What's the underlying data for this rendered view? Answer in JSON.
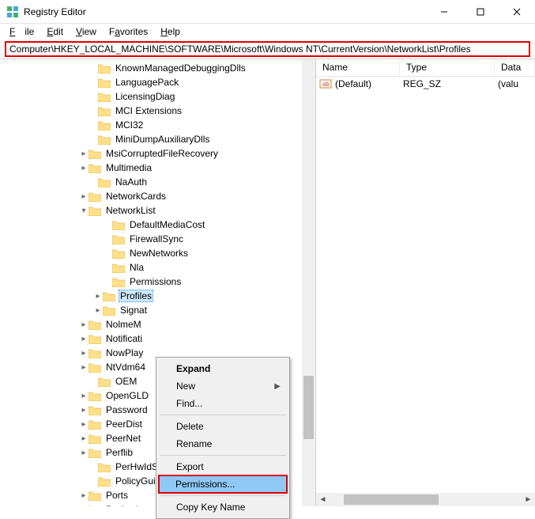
{
  "window": {
    "title": "Registry Editor"
  },
  "menus": {
    "file": "File",
    "edit": "Edit",
    "view": "View",
    "favorites": "Favorites",
    "help": "Help"
  },
  "address": "Computer\\HKEY_LOCAL_MACHINE\\SOFTWARE\\Microsoft\\Windows NT\\CurrentVersion\\NetworkList\\Profiles",
  "tree": [
    {
      "indent": 112,
      "caret": "",
      "label": "KnownManagedDebuggingDlls"
    },
    {
      "indent": 112,
      "caret": "",
      "label": "LanguagePack"
    },
    {
      "indent": 112,
      "caret": "",
      "label": "LicensingDiag"
    },
    {
      "indent": 112,
      "caret": "",
      "label": "MCI Extensions"
    },
    {
      "indent": 112,
      "caret": "",
      "label": "MCI32"
    },
    {
      "indent": 112,
      "caret": "",
      "label": "MiniDumpAuxiliaryDlls"
    },
    {
      "indent": 100,
      "caret": ">",
      "label": "MsiCorruptedFileRecovery"
    },
    {
      "indent": 100,
      "caret": ">",
      "label": "Multimedia"
    },
    {
      "indent": 112,
      "caret": "",
      "label": "NaAuth"
    },
    {
      "indent": 100,
      "caret": ">",
      "label": "NetworkCards"
    },
    {
      "indent": 100,
      "caret": "v",
      "label": "NetworkList"
    },
    {
      "indent": 130,
      "caret": "",
      "label": "DefaultMediaCost"
    },
    {
      "indent": 130,
      "caret": "",
      "label": "FirewallSync"
    },
    {
      "indent": 130,
      "caret": "",
      "label": "NewNetworks"
    },
    {
      "indent": 130,
      "caret": "",
      "label": "Nla"
    },
    {
      "indent": 130,
      "caret": "",
      "label": "Permissions"
    },
    {
      "indent": 118,
      "caret": ">",
      "label": "Profiles",
      "selected": true
    },
    {
      "indent": 118,
      "caret": ">",
      "label": "Signat"
    },
    {
      "indent": 100,
      "caret": ">",
      "label": "NolmeM"
    },
    {
      "indent": 100,
      "caret": ">",
      "label": "Notificati"
    },
    {
      "indent": 100,
      "caret": ">",
      "label": "NowPlay"
    },
    {
      "indent": 100,
      "caret": ">",
      "label": "NtVdm64"
    },
    {
      "indent": 112,
      "caret": "",
      "label": "OEM"
    },
    {
      "indent": 100,
      "caret": ">",
      "label": "OpenGLD"
    },
    {
      "indent": 100,
      "caret": ">",
      "label": "Password"
    },
    {
      "indent": 100,
      "caret": ">",
      "label": "PeerDist"
    },
    {
      "indent": 100,
      "caret": ">",
      "label": "PeerNet"
    },
    {
      "indent": 100,
      "caret": ">",
      "label": "Perflib"
    },
    {
      "indent": 112,
      "caret": "",
      "label": "PerHwIdStorage"
    },
    {
      "indent": 112,
      "caret": "",
      "label": "PolicyGuid"
    },
    {
      "indent": 100,
      "caret": ">",
      "label": "Ports"
    },
    {
      "indent": 100,
      "caret": ">",
      "label": "Prefetcher"
    }
  ],
  "list": {
    "headers": {
      "name": "Name",
      "type": "Type",
      "data": "Data"
    },
    "rows": [
      {
        "name": "(Default)",
        "type": "REG_SZ",
        "data": "(valu"
      }
    ]
  },
  "context_menu": {
    "expand": "Expand",
    "new": "New",
    "find": "Find...",
    "delete": "Delete",
    "rename": "Rename",
    "export": "Export",
    "permissions": "Permissions...",
    "copy_key_name": "Copy Key Name"
  }
}
